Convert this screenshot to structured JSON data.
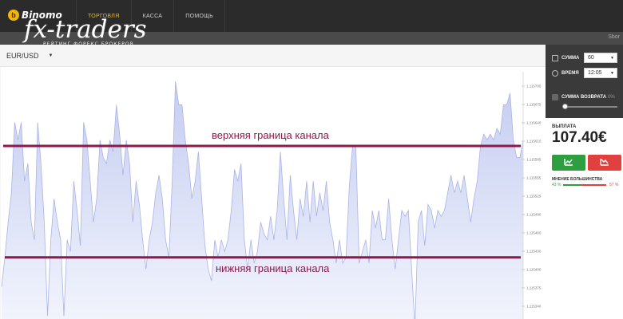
{
  "brand": {
    "coin": "b",
    "name": "Binomo"
  },
  "nav": [
    {
      "label": "ТОРГОВЛЯ",
      "active": true
    },
    {
      "label": "КАССА",
      "active": false
    },
    {
      "label": "ПОМОЩЬ",
      "active": false
    }
  ],
  "subbar": {
    "text": "Sbor"
  },
  "watermark": {
    "main": "fx-traders",
    "sub": "РЕЙТИНГ ФОРЕКС БРОКЕРОВ"
  },
  "chart_header": {
    "pair": "EUR/USD",
    "caret": "▼"
  },
  "chart_data": {
    "type": "area",
    "y_ticks": [
      "1.115705",
      "1.115675",
      "1.115640",
      "1.115610",
      "1.115585",
      "1.115555",
      "1.115525",
      "1.115490",
      "1.115460",
      "1.115430",
      "1.115400",
      "1.115375",
      "1.115340"
    ],
    "ylim": [
      1.11533,
      1.11572
    ],
    "values": [
      1.11537,
      1.11542,
      1.11548,
      1.11553,
      1.11565,
      1.11562,
      1.11565,
      1.11555,
      1.11558,
      1.11548,
      1.11545,
      1.11565,
      1.11558,
      1.11548,
      1.11532,
      1.11545,
      1.11552,
      1.11548,
      1.11545,
      1.11532,
      1.11545,
      1.11543,
      1.11555,
      1.1155,
      1.11544,
      1.11565,
      1.11562,
      1.11555,
      1.11548,
      1.11552,
      1.11562,
      1.11559,
      1.11558,
      1.11562,
      1.1156,
      1.11568,
      1.11563,
      1.11556,
      1.11562,
      1.11558,
      1.11548,
      1.11555,
      1.11551,
      1.11545,
      1.1154,
      1.11545,
      1.11548,
      1.11553,
      1.11556,
      1.11552,
      1.11545,
      1.11542,
      1.11555,
      1.11572,
      1.11568,
      1.11568,
      1.11562,
      1.11558,
      1.11552,
      1.11555,
      1.1156,
      1.11552,
      1.11544,
      1.1154,
      1.11538,
      1.11545,
      1.11542,
      1.11545,
      1.11543,
      1.11545,
      1.1155,
      1.11557,
      1.11555,
      1.11558,
      1.11545,
      1.1154,
      1.11545,
      1.11541,
      1.11543,
      1.11548,
      1.11546,
      1.11545,
      1.11549,
      1.11545,
      1.1155,
      1.1156,
      1.11552,
      1.11545,
      1.11556,
      1.1155,
      1.11545,
      1.11552,
      1.11549,
      1.11555,
      1.11548,
      1.11555,
      1.11549,
      1.11553,
      1.1155,
      1.11555,
      1.11548,
      1.11545,
      1.11541,
      1.11545,
      1.11541,
      1.11542,
      1.11554,
      1.11561,
      1.11561,
      1.11541,
      1.11543,
      1.11545,
      1.11541,
      1.1155,
      1.11547,
      1.1155,
      1.11545,
      1.11545,
      1.11552,
      1.11545,
      1.1154,
      1.11545,
      1.1155,
      1.11549,
      1.1155,
      1.1154,
      1.1153,
      1.11548,
      1.1155,
      1.11544,
      1.11551,
      1.1155,
      1.11547,
      1.1155,
      1.11549,
      1.1155,
      1.11553,
      1.11556,
      1.11553,
      1.11555,
      1.11553,
      1.11556,
      1.11552,
      1.11548,
      1.11552,
      1.11555,
      1.11561,
      1.11563,
      1.11562,
      1.11563,
      1.11562,
      1.11564,
      1.11563,
      1.11568,
      1.11568,
      1.1157,
      1.11562,
      1.11559,
      1.11559,
      1.11562
    ]
  },
  "annotations": {
    "upper": "верхняя граница канала",
    "lower": "нижняя граница канала",
    "upper_level": 1.11561,
    "lower_level": 1.11542,
    "line_color": "#8b1a4a"
  },
  "panel": {
    "amount_label": "СУММА",
    "amount_value": "60",
    "time_label": "ВРЕМЯ",
    "time_value": "12:05",
    "return_label": "СУММА ВОЗВРАТА",
    "return_pct": "0%",
    "return_level": 0,
    "payout_label": "ВЫПЛАТА",
    "payout_value": "107.40€",
    "majority_label": "МНЕНИЕ БОЛЬШИНСТВА",
    "majority_up_pct": "43 %",
    "majority_down_pct": "57 %",
    "majority_up": 43,
    "up_icon": "trend-up-icon",
    "down_icon": "trend-down-icon",
    "up_color": "#2f9e41",
    "down_color": "#e0413f"
  }
}
